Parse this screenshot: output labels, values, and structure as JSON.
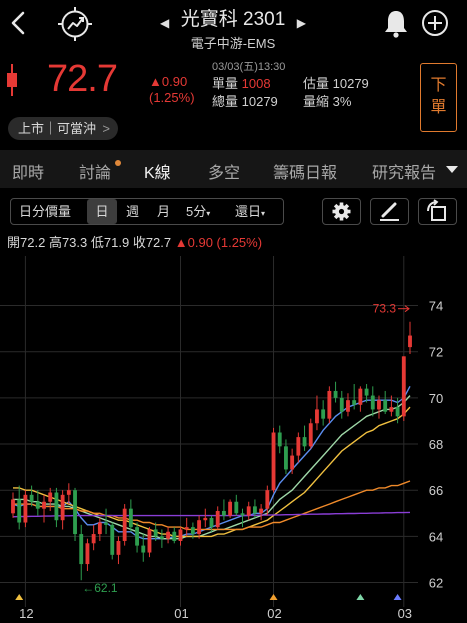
{
  "header": {
    "stock_name": "光寶科",
    "stock_code": "2301",
    "industry": "電子中游-EMS",
    "icons": [
      "back-chevron-icon",
      "trend-compass-icon",
      "bell-icon",
      "plus-circle-icon"
    ]
  },
  "quote": {
    "price": "72.7",
    "change": "▲0.90",
    "change_pct": "(1.25%)",
    "time": "03/03(五)13:30",
    "single_volume_label": "單量",
    "single_volume": "1008",
    "total_volume_label": "總量",
    "total_volume": "10279",
    "est_volume_label": "估量",
    "est_volume": "10279",
    "volume_ratio_label": "量縮",
    "volume_ratio": "3%",
    "order_button": "下單",
    "listing_status": "上市｜可當沖",
    "up_color": "#e53935",
    "down_color": "#2e9e4f",
    "accent_color": "#e07a2e"
  },
  "tabs": [
    {
      "label": "即時"
    },
    {
      "label": "討論"
    },
    {
      "label": "K線"
    },
    {
      "label": "多空"
    },
    {
      "label": "籌碼日報"
    },
    {
      "label": "研究報告"
    }
  ],
  "active_tab": "K線",
  "toolbar": {
    "indicator": "日分價量",
    "period_day": "日",
    "period_week": "週",
    "period_month": "月",
    "minute": "5分",
    "adjust": "還日",
    "icons": [
      "gear-icon",
      "pen-icon",
      "rotate-icon"
    ]
  },
  "ohlc": {
    "open": "開72.2",
    "high": "高73.3",
    "low": "低71.9",
    "close": "收72.7",
    "change": "▲0.90 (1.25%)"
  },
  "chart_data": {
    "type": "candlestick",
    "y_ticks": [
      "74",
      "72",
      "70",
      "68",
      "66",
      "64",
      "62"
    ],
    "ylim": [
      61.2,
      75.8
    ],
    "x_tick_labels": [
      {
        "label": "12",
        "index": 2
      },
      {
        "label": "01",
        "index": 27
      },
      {
        "label": "02",
        "index": 42
      },
      {
        "label": "03",
        "index": 63
      }
    ],
    "max_label": "73.3",
    "min_label": "←62.1",
    "candles": [
      [
        65.0,
        65.9,
        64.8,
        65.6
      ],
      [
        65.6,
        66.2,
        64.3,
        64.6
      ],
      [
        64.6,
        66.0,
        64.4,
        65.8
      ],
      [
        65.8,
        66.2,
        65.3,
        65.5
      ],
      [
        65.5,
        66.0,
        64.9,
        65.2
      ],
      [
        65.2,
        65.8,
        64.6,
        65.5
      ],
      [
        65.5,
        66.1,
        65.1,
        65.9
      ],
      [
        65.9,
        66.1,
        64.4,
        64.7
      ],
      [
        64.7,
        66.0,
        64.3,
        65.8
      ],
      [
        65.8,
        66.3,
        65.4,
        66.0
      ],
      [
        66.0,
        66.1,
        63.8,
        64.1
      ],
      [
        64.1,
        64.5,
        62.1,
        62.8
      ],
      [
        62.8,
        63.9,
        62.5,
        63.7
      ],
      [
        63.7,
        64.5,
        63.4,
        64.1
      ],
      [
        64.1,
        64.8,
        63.8,
        64.6
      ],
      [
        64.6,
        65.2,
        64.1,
        64.5
      ],
      [
        64.5,
        64.6,
        63.0,
        63.2
      ],
      [
        63.2,
        64.0,
        62.8,
        63.8
      ],
      [
        63.8,
        65.4,
        63.6,
        65.2
      ],
      [
        65.2,
        65.6,
        64.2,
        64.4
      ],
      [
        64.4,
        64.6,
        63.3,
        63.6
      ],
      [
        63.6,
        64.1,
        62.9,
        63.3
      ],
      [
        63.3,
        64.4,
        63.1,
        64.3
      ],
      [
        64.3,
        64.6,
        63.8,
        64.0
      ],
      [
        64.0,
        64.3,
        63.5,
        63.9
      ],
      [
        63.9,
        64.4,
        63.7,
        64.2
      ],
      [
        64.2,
        64.4,
        63.7,
        63.8
      ],
      [
        63.8,
        64.4,
        63.6,
        64.3
      ],
      [
        64.3,
        64.8,
        64.0,
        64.4
      ],
      [
        64.4,
        64.6,
        63.9,
        64.1
      ],
      [
        64.1,
        64.9,
        63.9,
        64.7
      ],
      [
        64.7,
        65.2,
        64.4,
        64.8
      ],
      [
        64.8,
        64.9,
        64.2,
        64.4
      ],
      [
        64.4,
        65.3,
        64.3,
        65.1
      ],
      [
        65.1,
        65.6,
        64.7,
        64.9
      ],
      [
        64.9,
        65.6,
        64.8,
        65.5
      ],
      [
        65.5,
        65.8,
        64.9,
        65.0
      ],
      [
        65.0,
        65.2,
        64.4,
        64.9
      ],
      [
        64.9,
        65.5,
        64.7,
        65.3
      ],
      [
        65.3,
        65.6,
        64.8,
        65.0
      ],
      [
        65.0,
        65.4,
        64.7,
        65.2
      ],
      [
        65.2,
        66.2,
        64.9,
        66.0
      ],
      [
        66.0,
        68.7,
        65.9,
        68.5
      ],
      [
        68.5,
        68.8,
        67.6,
        67.9
      ],
      [
        67.9,
        68.2,
        66.7,
        66.9
      ],
      [
        66.9,
        67.8,
        66.7,
        67.5
      ],
      [
        67.5,
        68.5,
        67.2,
        68.3
      ],
      [
        68.3,
        68.8,
        67.7,
        67.9
      ],
      [
        67.9,
        69.1,
        67.8,
        68.9
      ],
      [
        68.9,
        70.1,
        68.6,
        69.5
      ],
      [
        69.5,
        69.9,
        68.8,
        69.1
      ],
      [
        69.1,
        70.5,
        68.9,
        70.3
      ],
      [
        70.3,
        70.7,
        69.8,
        70.0
      ],
      [
        70.0,
        70.3,
        69.1,
        69.4
      ],
      [
        69.4,
        70.2,
        69.2,
        69.9
      ],
      [
        69.9,
        70.6,
        69.5,
        69.7
      ],
      [
        69.7,
        70.5,
        69.4,
        70.4
      ],
      [
        70.4,
        70.6,
        69.8,
        70.1
      ],
      [
        70.1,
        70.5,
        69.2,
        69.5
      ],
      [
        69.5,
        70.1,
        69.1,
        69.9
      ],
      [
        69.9,
        70.3,
        69.3,
        69.4
      ],
      [
        69.4,
        70.1,
        69.2,
        69.6
      ],
      [
        69.6,
        70.0,
        68.9,
        69.2
      ],
      [
        69.2,
        71.8,
        69.0,
        71.8
      ],
      [
        72.2,
        73.3,
        71.9,
        72.7
      ]
    ],
    "series": [
      {
        "color": "#5b8def",
        "values": [
          65.4,
          65.3,
          65.4,
          65.4,
          65.3,
          65.3,
          65.3,
          65.3,
          65.3,
          65.5,
          65.2,
          64.8,
          64.5,
          64.5,
          64.6,
          64.6,
          64.4,
          64.2,
          64.2,
          64.2,
          64.0,
          63.9,
          63.9,
          63.9,
          63.9,
          63.9,
          64.0,
          64.0,
          64.1,
          64.1,
          64.2,
          64.3,
          64.4,
          64.5,
          64.6,
          64.7,
          64.8,
          64.9,
          64.9,
          65.0,
          65.0,
          65.2,
          65.8,
          66.3,
          66.6,
          66.9,
          67.2,
          67.5,
          67.8,
          68.2,
          68.6,
          68.9,
          69.2,
          69.4,
          69.6,
          69.7,
          69.8,
          69.9,
          69.9,
          69.9,
          69.9,
          69.9,
          69.8,
          70.0,
          70.5
        ]
      },
      {
        "color": "#9fd8a8",
        "values": [
          65.6,
          65.6,
          65.6,
          65.5,
          65.5,
          65.4,
          65.4,
          65.4,
          65.3,
          65.3,
          65.2,
          65.1,
          65.0,
          64.9,
          64.8,
          64.7,
          64.6,
          64.5,
          64.4,
          64.3,
          64.2,
          64.1,
          64.0,
          64.0,
          63.9,
          63.9,
          63.9,
          63.9,
          64.0,
          64.0,
          64.0,
          64.1,
          64.2,
          64.3,
          64.3,
          64.4,
          64.5,
          64.6,
          64.7,
          64.8,
          64.9,
          65.0,
          65.3,
          65.6,
          65.8,
          66.0,
          66.3,
          66.6,
          66.9,
          67.2,
          67.5,
          67.8,
          68.1,
          68.4,
          68.6,
          68.8,
          69.0,
          69.2,
          69.3,
          69.4,
          69.5,
          69.5,
          69.6,
          69.8,
          70.1
        ]
      },
      {
        "color": "#f0c040",
        "values": [
          66.1,
          66.1,
          66.0,
          66.0,
          65.9,
          65.8,
          65.7,
          65.6,
          65.5,
          65.4,
          65.3,
          65.2,
          65.1,
          65.0,
          64.9,
          64.9,
          64.8,
          64.7,
          64.7,
          64.6,
          64.5,
          64.4,
          64.3,
          64.2,
          64.1,
          64.1,
          64.0,
          64.0,
          64.0,
          64.0,
          64.0,
          64.0,
          64.0,
          64.1,
          64.1,
          64.2,
          64.3,
          64.3,
          64.4,
          64.5,
          64.6,
          64.7,
          64.9,
          65.1,
          65.3,
          65.5,
          65.7,
          65.9,
          66.2,
          66.5,
          66.8,
          67.1,
          67.4,
          67.7,
          67.9,
          68.1,
          68.3,
          68.5,
          68.6,
          68.8,
          68.9,
          69.0,
          69.1,
          69.3,
          69.6
        ]
      },
      {
        "color": "#f08a2a",
        "values": [
          65.4,
          65.4,
          65.4,
          65.4,
          65.3,
          65.3,
          65.3,
          65.3,
          65.2,
          65.2,
          65.2,
          65.1,
          65.1,
          65.0,
          65.0,
          64.9,
          64.9,
          64.8,
          64.8,
          64.7,
          64.7,
          64.6,
          64.6,
          64.5,
          64.5,
          64.4,
          64.4,
          64.4,
          64.3,
          64.3,
          64.3,
          64.3,
          64.3,
          64.3,
          64.3,
          64.3,
          64.3,
          64.3,
          64.4,
          64.4,
          64.4,
          64.5,
          64.6,
          64.6,
          64.7,
          64.8,
          64.9,
          65.0,
          65.1,
          65.2,
          65.3,
          65.4,
          65.5,
          65.6,
          65.7,
          65.8,
          65.9,
          66.0,
          66.0,
          66.1,
          66.1,
          66.2,
          66.2,
          66.3,
          66.4
        ]
      },
      {
        "color": "#8a3ed6",
        "values": [
          64.85,
          64.86,
          64.86,
          64.87,
          64.87,
          64.88,
          64.88,
          64.89,
          64.89,
          64.89,
          64.9,
          64.9,
          64.9,
          64.9,
          64.9,
          64.9,
          64.9,
          64.9,
          64.9,
          64.9,
          64.9,
          64.9,
          64.9,
          64.9,
          64.9,
          64.9,
          64.9,
          64.9,
          64.9,
          64.9,
          64.9,
          64.9,
          64.9,
          64.9,
          64.9,
          64.9,
          64.91,
          64.91,
          64.91,
          64.91,
          64.92,
          64.92,
          64.93,
          64.93,
          64.94,
          64.94,
          64.95,
          64.95,
          64.96,
          64.96,
          64.97,
          64.97,
          64.98,
          64.98,
          64.99,
          64.99,
          65.0,
          65.0,
          65.01,
          65.01,
          65.02,
          65.02,
          65.03,
          65.03,
          65.04
        ]
      }
    ],
    "markers": [
      {
        "index": 1,
        "color": "#f0c040"
      },
      {
        "index": 42,
        "color": "#f0a030"
      },
      {
        "index": 56,
        "color": "#7fd6a8"
      },
      {
        "index": 62,
        "color": "#6b7cff"
      }
    ]
  }
}
